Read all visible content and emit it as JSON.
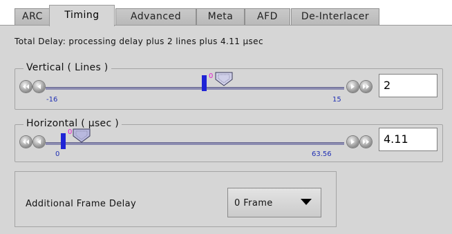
{
  "tabs": [
    {
      "label": "ARC",
      "active": false
    },
    {
      "label": "Timing",
      "active": true
    },
    {
      "label": "Advanced",
      "active": false
    },
    {
      "label": "Meta",
      "active": false
    },
    {
      "label": "AFD",
      "active": false
    },
    {
      "label": "De-Interlacer",
      "active": false
    }
  ],
  "total_delay_text": "Total Delay: processing delay  plus 2 lines plus 4.11 μsec",
  "vertical": {
    "title": "Vertical ( Lines )",
    "min_label": "-16",
    "max_label": "15",
    "zero_label": "0",
    "value": "2"
  },
  "horizontal": {
    "title": "Horizontal ( μsec )",
    "min_label": "0",
    "max_label": "63.56",
    "zero_label": "0",
    "value": "4.11"
  },
  "frame_delay": {
    "label": "Additional Frame Delay",
    "selected": "0 Frame"
  },
  "colors": {
    "panel_bg": "#d6d6d6",
    "marker": "#1f24d6",
    "range_label": "#1f2fb3",
    "zero_label": "#e01ccf"
  },
  "icons": {
    "step_back": "double-left-arrow-icon",
    "step_back_one": "left-arrow-icon",
    "step_forward_one": "right-arrow-icon",
    "step_forward": "double-right-arrow-icon",
    "dropdown": "caret-down-icon"
  }
}
